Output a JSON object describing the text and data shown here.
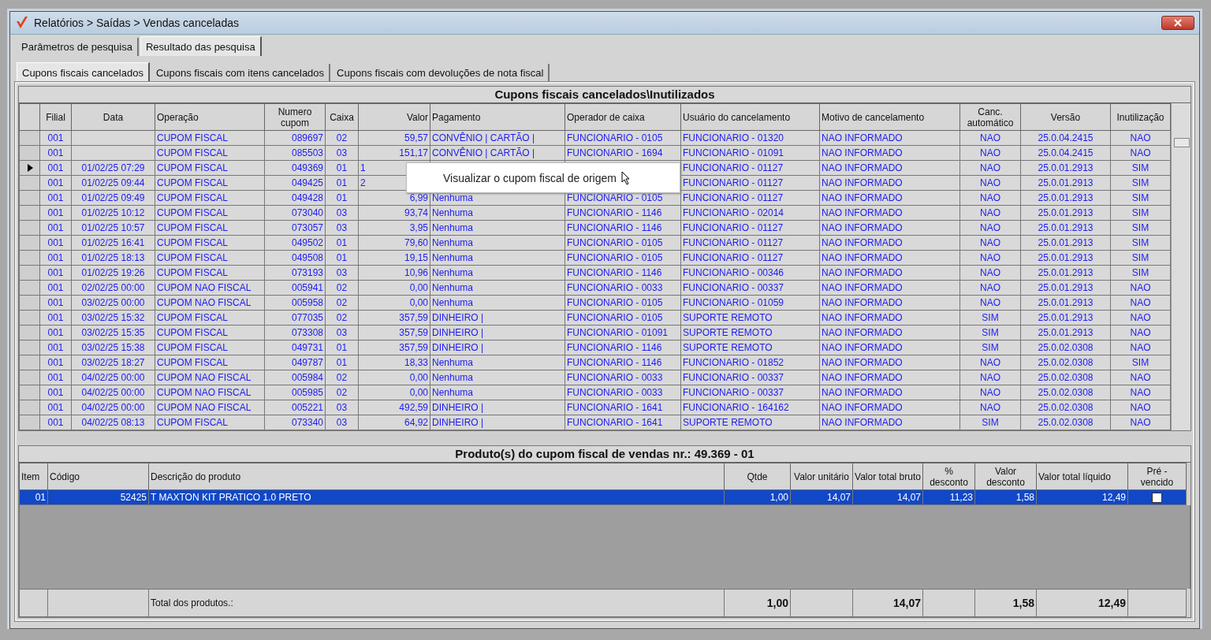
{
  "window": {
    "title": "Relatórios > Saídas > Vendas canceladas"
  },
  "tabs": [
    {
      "label": "Parâmetros de pesquisa",
      "selected": false
    },
    {
      "label": "Resultado das pesquisa",
      "selected": true
    }
  ],
  "subtabs": [
    {
      "label": "Cupons fiscais cancelados",
      "selected": true
    },
    {
      "label": "Cupons fiscais com itens cancelados",
      "selected": false
    },
    {
      "label": "Cupons fiscais com devoluções de nota fiscal",
      "selected": false
    }
  ],
  "cupons": {
    "title": "Cupons fiscais cancelados\\Inutilizados",
    "columns": [
      "Filial",
      "Data",
      "Operação",
      "Numero cupom",
      "Caixa",
      "Valor",
      "Pagamento",
      "Operador de caixa",
      "Usuário do cancelamento",
      "Motivo de cancelamento",
      "Canc. automático",
      "Versão",
      "Inutilização"
    ],
    "rows": [
      {
        "selected": false,
        "covered": false,
        "filial": "001",
        "operacao": "CUPOM FISCAL",
        "numero": "089697",
        "caixa": "02",
        "valor": "59,57",
        "pagamento": "CONVÊNIO | CARTÃO |",
        "operador": "FUNCIONARIO - 0105",
        "usuario": "FUNCIONARIO - 01320",
        "motivo": "NAO INFORMADO",
        "canc_auto": "NAO",
        "versao": "25.0.04.2415",
        "inutilizacao": "NAO"
      },
      {
        "selected": false,
        "covered": false,
        "filial": "001",
        "operacao": "CUPOM FISCAL",
        "numero": "085503",
        "caixa": "03",
        "valor": "151,17",
        "pagamento": "CONVÊNIO | CARTÃO |",
        "operador": "FUNCIONARIO - 1694",
        "usuario": "FUNCIONARIO - 01091",
        "motivo": "NAO INFORMADO",
        "canc_auto": "NAO",
        "versao": "25.0.04.2415",
        "inutilizacao": "NAO"
      },
      {
        "selected": true,
        "covered": true,
        "filial": "001",
        "data": "01/02/25 07:29",
        "operacao": "CUPOM FISCAL",
        "numero": "049369",
        "caixa": "01",
        "valor": "1",
        "usuario": "FUNCIONARIO - 01127",
        "motivo": "NAO INFORMADO",
        "canc_auto": "NAO",
        "versao": "25.0.01.2913",
        "inutilizacao": "SIM"
      },
      {
        "selected": false,
        "covered": true,
        "filial": "001",
        "data": "01/02/25 09:44",
        "operacao": "CUPOM FISCAL",
        "numero": "049425",
        "caixa": "01",
        "valor": "2",
        "usuario": "FUNCIONARIO - 01127",
        "motivo": "NAO INFORMADO",
        "canc_auto": "NAO",
        "versao": "25.0.01.2913",
        "inutilizacao": "SIM"
      },
      {
        "selected": false,
        "covered": false,
        "filial": "001",
        "data": "01/02/25 09:49",
        "operacao": "CUPOM FISCAL",
        "numero": "049428",
        "caixa": "01",
        "valor": "6,99",
        "pagamento": "Nenhuma",
        "operador": "FUNCIONARIO - 0105",
        "usuario": "FUNCIONARIO - 01127",
        "motivo": "NAO INFORMADO",
        "canc_auto": "NAO",
        "versao": "25.0.01.2913",
        "inutilizacao": "SIM"
      },
      {
        "selected": false,
        "covered": false,
        "filial": "001",
        "data": "01/02/25 10:12",
        "operacao": "CUPOM FISCAL",
        "numero": "073040",
        "caixa": "03",
        "valor": "93,74",
        "pagamento": "Nenhuma",
        "operador": "FUNCIONARIO - 1146",
        "usuario": "FUNCIONARIO - 02014",
        "motivo": "NAO INFORMADO",
        "canc_auto": "NAO",
        "versao": "25.0.01.2913",
        "inutilizacao": "SIM"
      },
      {
        "selected": false,
        "covered": false,
        "filial": "001",
        "data": "01/02/25 10:57",
        "operacao": "CUPOM FISCAL",
        "numero": "073057",
        "caixa": "03",
        "valor": "3,95",
        "pagamento": "Nenhuma",
        "operador": "FUNCIONARIO - 1146",
        "usuario": "FUNCIONARIO - 01127",
        "motivo": "NAO INFORMADO",
        "canc_auto": "NAO",
        "versao": "25.0.01.2913",
        "inutilizacao": "SIM"
      },
      {
        "selected": false,
        "covered": false,
        "filial": "001",
        "data": "01/02/25 16:41",
        "operacao": "CUPOM FISCAL",
        "numero": "049502",
        "caixa": "01",
        "valor": "79,60",
        "pagamento": "Nenhuma",
        "operador": "FUNCIONARIO - 0105",
        "usuario": "FUNCIONARIO - 01127",
        "motivo": "NAO INFORMADO",
        "canc_auto": "NAO",
        "versao": "25.0.01.2913",
        "inutilizacao": "SIM"
      },
      {
        "selected": false,
        "covered": false,
        "filial": "001",
        "data": "01/02/25 18:13",
        "operacao": "CUPOM FISCAL",
        "numero": "049508",
        "caixa": "01",
        "valor": "19,15",
        "pagamento": "Nenhuma",
        "operador": "FUNCIONARIO - 0105",
        "usuario": "FUNCIONARIO - 01127",
        "motivo": "NAO INFORMADO",
        "canc_auto": "NAO",
        "versao": "25.0.01.2913",
        "inutilizacao": "SIM"
      },
      {
        "selected": false,
        "covered": false,
        "filial": "001",
        "data": "01/02/25 19:26",
        "operacao": "CUPOM FISCAL",
        "numero": "073193",
        "caixa": "03",
        "valor": "10,96",
        "pagamento": "Nenhuma",
        "operador": "FUNCIONARIO - 1146",
        "usuario": "FUNCIONARIO - 00346",
        "motivo": "NAO INFORMADO",
        "canc_auto": "NAO",
        "versao": "25.0.01.2913",
        "inutilizacao": "SIM"
      },
      {
        "selected": false,
        "covered": false,
        "filial": "001",
        "data": "02/02/25 00:00",
        "operacao": "CUPOM NAO FISCAL",
        "numero": "005941",
        "caixa": "02",
        "valor": "0,00",
        "pagamento": "Nenhuma",
        "operador": "FUNCIONARIO - 0033",
        "usuario": "FUNCIONARIO - 00337",
        "motivo": "NAO INFORMADO",
        "canc_auto": "NAO",
        "versao": "25.0.01.2913",
        "inutilizacao": "NAO"
      },
      {
        "selected": false,
        "covered": false,
        "filial": "001",
        "data": "03/02/25 00:00",
        "operacao": "CUPOM NAO FISCAL",
        "numero": "005958",
        "caixa": "02",
        "valor": "0,00",
        "pagamento": "Nenhuma",
        "operador": "FUNCIONARIO - 0105",
        "usuario": "FUNCIONARIO - 01059",
        "motivo": "NAO INFORMADO",
        "canc_auto": "NAO",
        "versao": "25.0.01.2913",
        "inutilizacao": "NAO"
      },
      {
        "selected": false,
        "covered": false,
        "filial": "001",
        "data": "03/02/25 15:32",
        "operacao": "CUPOM FISCAL",
        "numero": "077035",
        "caixa": "02",
        "valor": "357,59",
        "pagamento": "DINHEIRO |",
        "operador": "FUNCIONARIO - 0105",
        "usuario": "SUPORTE REMOTO",
        "motivo": "NAO INFORMADO",
        "canc_auto": "SIM",
        "versao": "25.0.01.2913",
        "inutilizacao": "NAO"
      },
      {
        "selected": false,
        "covered": false,
        "filial": "001",
        "data": "03/02/25 15:35",
        "operacao": "CUPOM FISCAL",
        "numero": "073308",
        "caixa": "03",
        "valor": "357,59",
        "pagamento": "DINHEIRO |",
        "operador": "FUNCIONARIO - 01091",
        "usuario": "SUPORTE REMOTO",
        "motivo": "NAO INFORMADO",
        "canc_auto": "SIM",
        "versao": "25.0.01.2913",
        "inutilizacao": "NAO"
      },
      {
        "selected": false,
        "covered": false,
        "filial": "001",
        "data": "03/02/25 15:38",
        "operacao": "CUPOM FISCAL",
        "numero": "049731",
        "caixa": "01",
        "valor": "357,59",
        "pagamento": "DINHEIRO |",
        "operador": "FUNCIONARIO - 1146",
        "usuario": "SUPORTE REMOTO",
        "motivo": "NAO INFORMADO",
        "canc_auto": "SIM",
        "versao": "25.0.02.0308",
        "inutilizacao": "NAO"
      },
      {
        "selected": false,
        "covered": false,
        "filial": "001",
        "data": "03/02/25 18:27",
        "operacao": "CUPOM FISCAL",
        "numero": "049787",
        "caixa": "01",
        "valor": "18,33",
        "pagamento": "Nenhuma",
        "operador": "FUNCIONARIO - 1146",
        "usuario": "FUNCIONARIO - 01852",
        "motivo": "NAO INFORMADO",
        "canc_auto": "NAO",
        "versao": "25.0.02.0308",
        "inutilizacao": "SIM"
      },
      {
        "selected": false,
        "covered": false,
        "filial": "001",
        "data": "04/02/25 00:00",
        "operacao": "CUPOM NAO FISCAL",
        "numero": "005984",
        "caixa": "02",
        "valor": "0,00",
        "pagamento": "Nenhuma",
        "operador": "FUNCIONARIO - 0033",
        "usuario": "FUNCIONARIO - 00337",
        "motivo": "NAO INFORMADO",
        "canc_auto": "NAO",
        "versao": "25.0.02.0308",
        "inutilizacao": "NAO"
      },
      {
        "selected": false,
        "covered": false,
        "filial": "001",
        "data": "04/02/25 00:00",
        "operacao": "CUPOM NAO FISCAL",
        "numero": "005985",
        "caixa": "02",
        "valor": "0,00",
        "pagamento": "Nenhuma",
        "operador": "FUNCIONARIO - 0033",
        "usuario": "FUNCIONARIO - 00337",
        "motivo": "NAO INFORMADO",
        "canc_auto": "NAO",
        "versao": "25.0.02.0308",
        "inutilizacao": "NAO"
      },
      {
        "selected": false,
        "covered": false,
        "filial": "001",
        "data": "04/02/25 00:00",
        "operacao": "CUPOM NAO FISCAL",
        "numero": "005221",
        "caixa": "03",
        "valor": "492,59",
        "pagamento": "DINHEIRO |",
        "operador": "FUNCIONARIO - 1641",
        "usuario": "FUNCIONARIO - 164162",
        "motivo": "NAO INFORMADO",
        "canc_auto": "NAO",
        "versao": "25.0.02.0308",
        "inutilizacao": "NAO"
      },
      {
        "selected": false,
        "covered": false,
        "filial": "001",
        "data": "04/02/25 08:13",
        "operacao": "CUPOM FISCAL",
        "numero": "073340",
        "caixa": "03",
        "valor": "64,92",
        "pagamento": "DINHEIRO |",
        "operador": "FUNCIONARIO - 1641",
        "usuario": "SUPORTE REMOTO",
        "motivo": "NAO INFORMADO",
        "canc_auto": "SIM",
        "versao": "25.0.02.0308",
        "inutilizacao": "NAO"
      }
    ]
  },
  "tooltip": {
    "text": "Visualizar o cupom fiscal de origem"
  },
  "produtos": {
    "title": "Produto(s) do cupom fiscal de vendas nr.: 49.369 - 01",
    "columns": [
      "Item",
      "Código",
      "Descrição do produto",
      "Qtde",
      "Valor unitário",
      "Valor total bruto",
      "% desconto",
      "Valor desconto",
      "Valor total líquido",
      "Pré - vencido"
    ],
    "rows": [
      {
        "selected": true,
        "item": "01",
        "codigo": "52425",
        "descricao": "T MAXTON KIT PRATICO 1.0 PRETO",
        "qtde": "1,00",
        "valor_unitario": "14,07",
        "valor_total_bruto": "14,07",
        "desconto_pct": "11,23",
        "valor_desconto": "1,58",
        "valor_total_liquido": "12,49",
        "pre_vencido": false
      }
    ],
    "totals": {
      "label": "Total dos produtos.:",
      "qtde": "1,00",
      "valor_total_bruto": "14,07",
      "valor_desconto": "1,58",
      "valor_total_liquido": "12,49"
    }
  }
}
